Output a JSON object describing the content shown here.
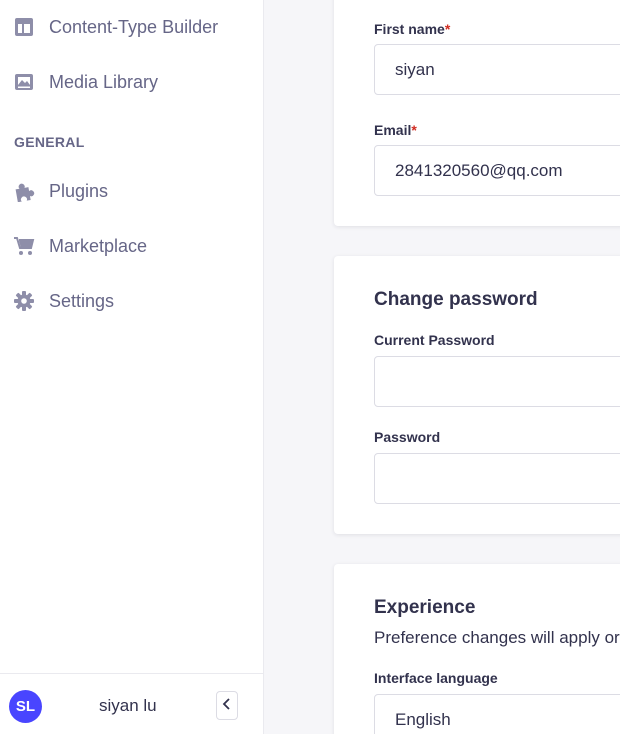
{
  "sidebar": {
    "items": [
      {
        "label": "Content-Type Builder",
        "icon": "layout-icon"
      },
      {
        "label": "Media Library",
        "icon": "image-icon"
      }
    ],
    "section_title": "GENERAL",
    "general_items": [
      {
        "label": "Plugins",
        "icon": "puzzle-icon"
      },
      {
        "label": "Marketplace",
        "icon": "cart-icon"
      },
      {
        "label": "Settings",
        "icon": "gear-icon"
      }
    ],
    "footer": {
      "avatar_initials": "SL",
      "user_name": "siyan lu",
      "collapse_icon": "chevron-left-icon"
    }
  },
  "profile": {
    "first_name_label": "First name",
    "first_name_value": "siyan",
    "email_label": "Email",
    "email_value": "2841320560@qq.com",
    "required_marker": "*"
  },
  "change_password": {
    "title": "Change password",
    "current_password_label": "Current Password",
    "current_password_value": "",
    "password_label": "Password",
    "password_value": ""
  },
  "experience": {
    "title": "Experience",
    "description": "Preference changes will apply or",
    "language_label": "Interface language",
    "language_value": "English"
  },
  "colors": {
    "accent": "#4945ff",
    "required": "#d02b20",
    "sidebar_icon": "#8e8ea9"
  }
}
